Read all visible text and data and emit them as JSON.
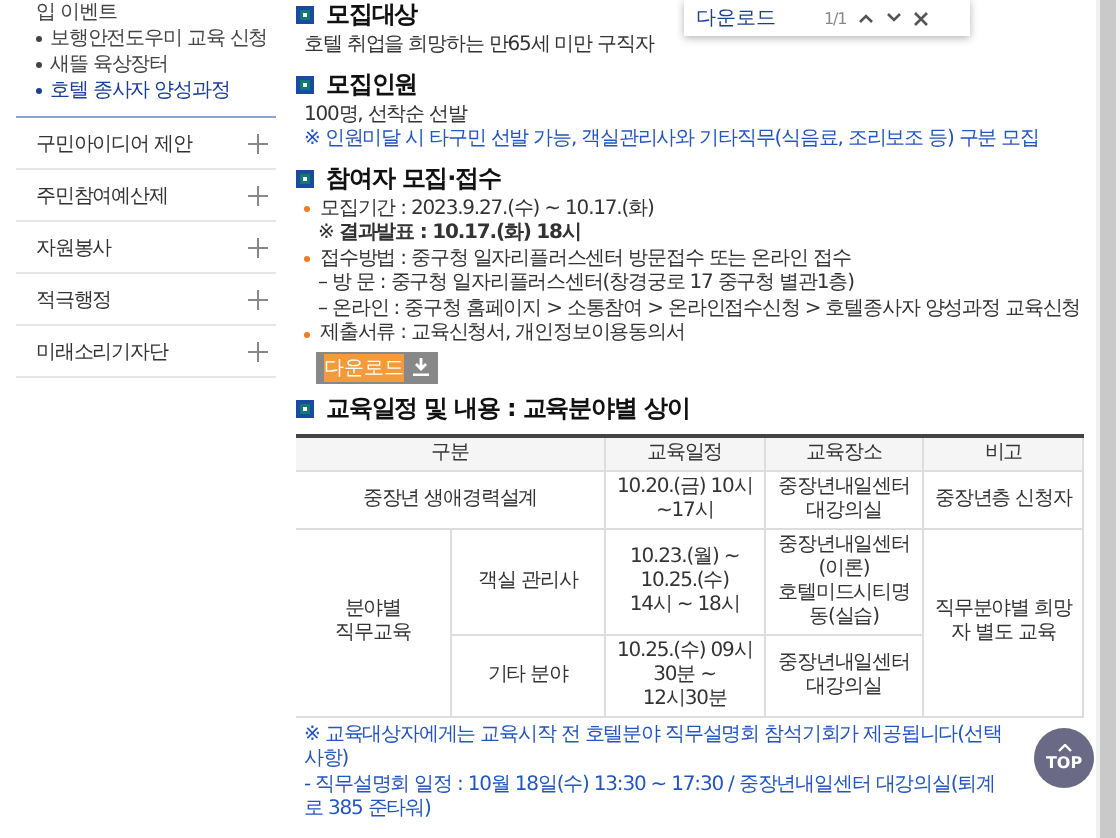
{
  "sidebar": {
    "submenu": [
      {
        "label": "입 이벤트",
        "bullet": false,
        "selected": false
      },
      {
        "label": "보행안전도우미 교육 신청",
        "bullet": true,
        "selected": false
      },
      {
        "label": "새뜰 육상장터",
        "bullet": true,
        "selected": false
      },
      {
        "label": "호텔 종사자 양성과정",
        "bullet": true,
        "selected": true
      }
    ],
    "menu": [
      {
        "label": "구민아이디어 제안",
        "expanded": false
      },
      {
        "label": "주민참여예산제",
        "expanded": false
      },
      {
        "label": "자원봉사",
        "expanded": false
      },
      {
        "label": "적극행정",
        "expanded": false
      },
      {
        "label": "미래소리기자단",
        "expanded": false
      }
    ]
  },
  "find_bar": {
    "value": "다운로드",
    "count": "1/1"
  },
  "sections": [
    {
      "title": "모집대상",
      "lines": [
        {
          "kind": "plain",
          "text": "호텔 취업을 희망하는 만65세 미만 구직자"
        }
      ]
    },
    {
      "title": "모집인원",
      "lines": [
        {
          "kind": "plain",
          "text": "100명, 선착순 선발"
        },
        {
          "kind": "note",
          "text": "※ 인원미달 시 타구민 선발 가능, 객실관리사와 기타직무(식음료, 조리보조 등) 구분 모집"
        }
      ]
    },
    {
      "title": "참여자 모집·접수",
      "lines": [
        {
          "kind": "bullet",
          "text": "모집기간 : 2023.9.27.(수) ~ 10.17.(화)"
        },
        {
          "kind": "sub",
          "text": "※ **결과발표 : 10.17.(화) 18시**"
        },
        {
          "kind": "bullet",
          "text": "접수방법 : 중구청 일자리플러스센터 방문접수 또는 온라인 접수"
        },
        {
          "kind": "dash",
          "text": "– 방 문 : 중구청 일자리플러스센터(창경궁로 17 중구청 별관1층)"
        },
        {
          "kind": "dash",
          "text": "– 온라인 : 중구청 홈페이지 > 소통참여 > 온라인접수신청 > 호텔종사자 양성과정 교육신청"
        },
        {
          "kind": "bullet",
          "text": "제출서류 : 교육신청서, 개인정보이용동의서"
        }
      ],
      "download": {
        "label": "다운로드",
        "find_match": true
      }
    },
    {
      "title": "교육일정 및 내용 : 교육분야별 상이"
    }
  ],
  "table": {
    "columns": [
      "구분",
      "교육일정",
      "교육장소",
      "비고"
    ],
    "row": {
      "category": "중장년 생애경력설계",
      "schedule": [
        "10.20.(금) 10시~17시"
      ],
      "place": [
        "중장년내일센터 대강의실"
      ],
      "note": "중장년층 신청자"
    },
    "group": {
      "category": [
        "분야별",
        "직무교육"
      ],
      "note": "직무분야별 희망자 별도 교육",
      "subrows": [
        {
          "field": "객실 관리사",
          "schedule": [
            "10.23.(월) ~ 10.25.(수)",
            "14시 ~ 18시"
          ],
          "place": [
            "중장년내일센터(이론)",
            "호텔미드시티명동(실습)"
          ]
        },
        {
          "field": "기타 분야",
          "schedule": [
            "10.25.(수) 09시30분 ~",
            "12시30분"
          ],
          "place": [
            "중장년내일센터 대강의실"
          ]
        }
      ]
    }
  },
  "notes": [
    "※ 교육대상자에게는 교육시작 전 호텔분야 직무설명회 참석기회가 제공됩니다(선택사항)",
    "- 직무설명회 일정 : 10월 18일(수) 13:30 ~ 17:30 / 중장년내일센터 대강의실(퇴계로 385 준타워)"
  ],
  "top_button": {
    "label": "TOP"
  }
}
